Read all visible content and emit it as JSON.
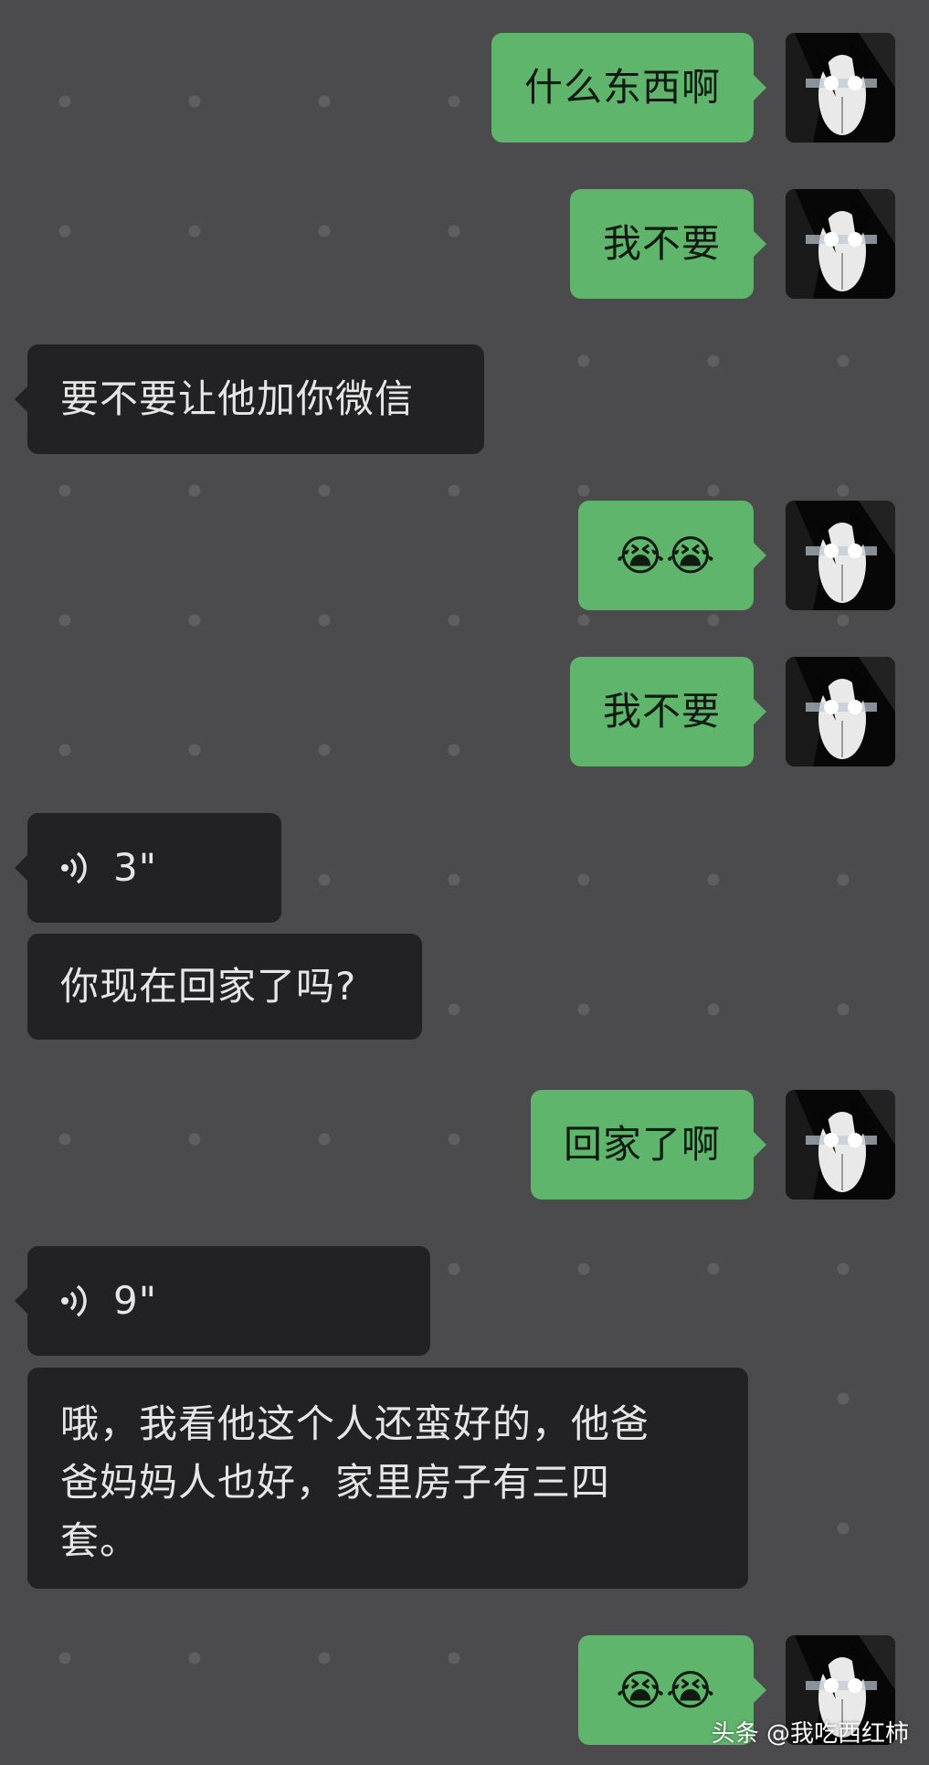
{
  "messages": [
    {
      "from": "me",
      "text": "什么东西啊"
    },
    {
      "from": "me",
      "text": "我不要"
    },
    {
      "from": "other",
      "text": "要不要让他加你微信"
    },
    {
      "from": "me",
      "text": "😭😭"
    },
    {
      "from": "me",
      "text": "我不要"
    },
    {
      "from": "other",
      "type": "voice",
      "duration": "3\""
    },
    {
      "from": "other",
      "text": "你现在回家了吗?"
    },
    {
      "from": "me",
      "text": "回家了啊"
    },
    {
      "from": "other",
      "type": "voice",
      "duration": "9\""
    },
    {
      "from": "other",
      "text_lines": [
        "哦，我看他这个人还蛮好的，他爸",
        "爸妈妈人也好，家里房子有三四",
        "套。"
      ]
    },
    {
      "from": "me",
      "text": "😭😭"
    }
  ],
  "icons": {
    "voice": "voice-wave-icon",
    "avatar": "avatar-image"
  },
  "colors": {
    "me_bubble": "#5fb56b",
    "other_bubble": "#222224",
    "background": "#4b4b4d"
  },
  "watermark": "头条 @我吃西红柿"
}
